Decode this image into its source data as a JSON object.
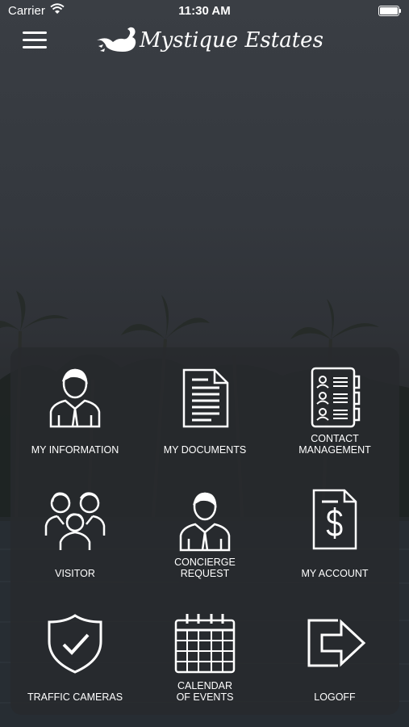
{
  "status_bar": {
    "carrier": "Carrier",
    "time": "11:30 AM"
  },
  "header": {
    "title": "Mystique Estates",
    "menu_icon": "hamburger-menu-icon",
    "logo_icon": "swan-icon"
  },
  "menu": [
    {
      "label": "MY INFORMATION",
      "icon": "person-icon"
    },
    {
      "label": "MY DOCUMENTS",
      "icon": "document-icon"
    },
    {
      "label": "CONTACT MANAGEMENT",
      "line1": "CONTACT",
      "line2": "MANAGEMENT",
      "icon": "contacts-book-icon"
    },
    {
      "label": "VISITOR",
      "icon": "family-icon"
    },
    {
      "label": "CONCIERGE REQUEST",
      "line1": "CONCIERGE",
      "line2": "REQUEST",
      "icon": "concierge-person-icon"
    },
    {
      "label": "MY ACCOUNT",
      "icon": "dollar-document-icon"
    },
    {
      "label": "TRAFFIC CAMERAS",
      "icon": "shield-check-icon"
    },
    {
      "label": "CALENDAR OF EVENTS",
      "line1": "CALENDAR",
      "line2": "OF EVENTS",
      "icon": "calendar-icon"
    },
    {
      "label": "LOGOFF",
      "icon": "logout-arrow-icon"
    }
  ]
}
